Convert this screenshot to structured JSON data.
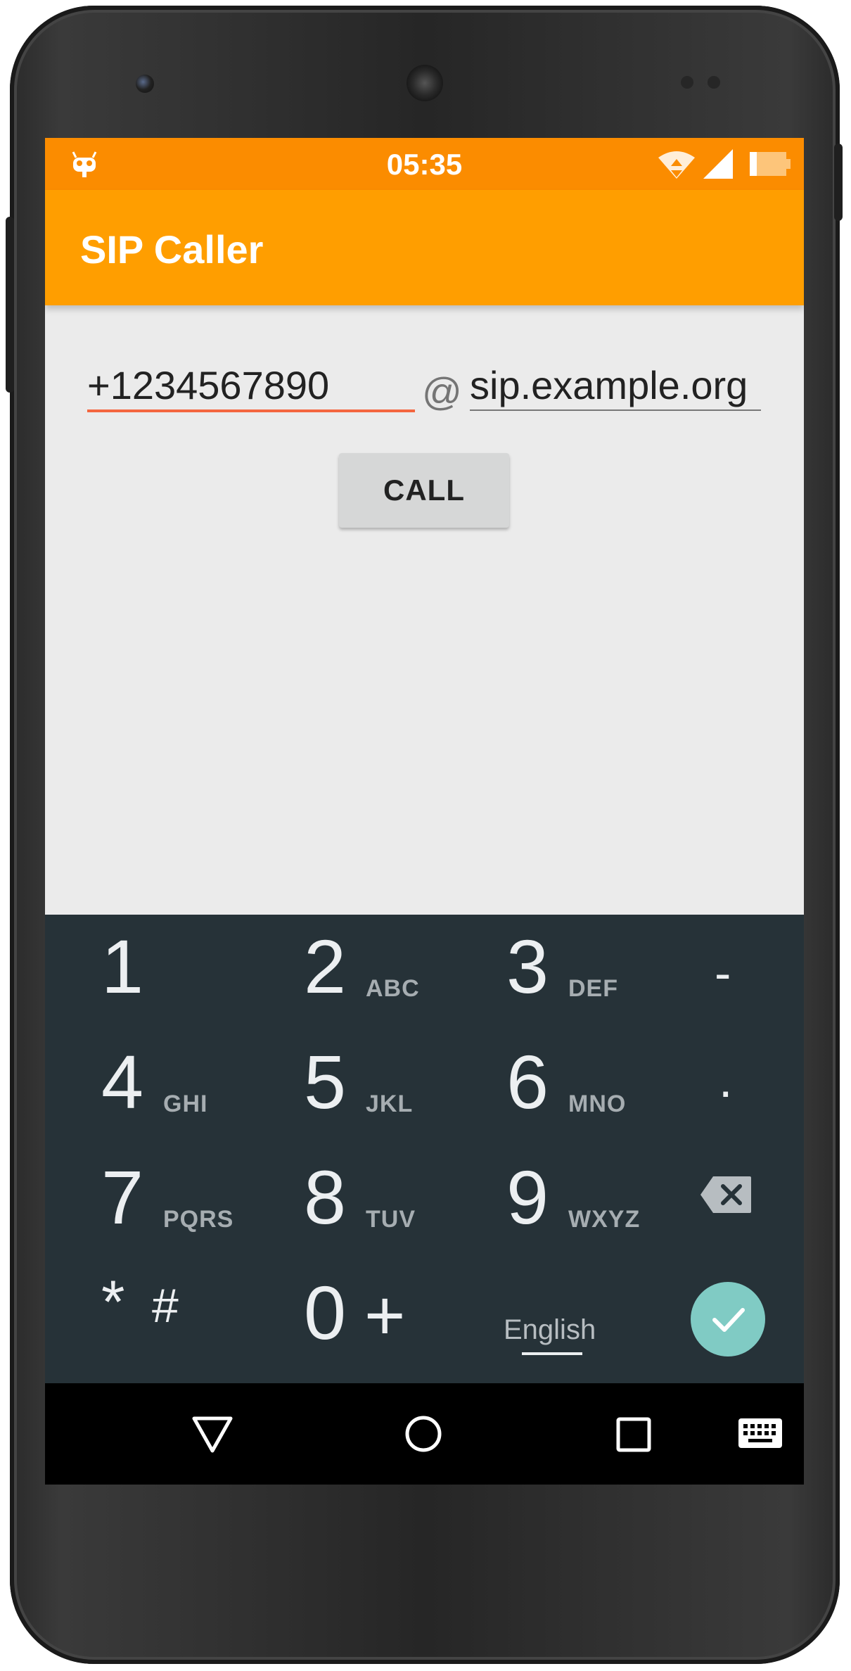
{
  "status_bar": {
    "time": "05:35",
    "icons": [
      "android-debug-icon",
      "wifi-icon",
      "signal-icon",
      "battery-icon"
    ]
  },
  "app_bar": {
    "title": "SIP Caller"
  },
  "form": {
    "number_value": "+1234567890",
    "at_symbol": "@",
    "domain_value": "sip.example.org",
    "call_label": "CALL"
  },
  "keypad": {
    "keys": [
      {
        "digit": "1",
        "letters": ""
      },
      {
        "digit": "2",
        "letters": "ABC"
      },
      {
        "digit": "3",
        "letters": "DEF"
      },
      {
        "digit": "4",
        "letters": "GHI"
      },
      {
        "digit": "5",
        "letters": "JKL"
      },
      {
        "digit": "6",
        "letters": "MNO"
      },
      {
        "digit": "7",
        "letters": "PQRS"
      },
      {
        "digit": "8",
        "letters": "TUV"
      },
      {
        "digit": "9",
        "letters": "WXYZ"
      }
    ],
    "dash": "-",
    "dot": ".",
    "star": "*",
    "hash": "#",
    "zero": "0",
    "plus": "+",
    "language": "English"
  },
  "colors": {
    "status_bar": "#fb8c00",
    "app_bar": "#ff9e00",
    "accent_underline": "#f4663f",
    "keypad_bg": "#263238",
    "done_button": "#80cbc4"
  },
  "nav_bar": {
    "icons": [
      "back-icon",
      "home-icon",
      "recents-icon",
      "keyboard-icon"
    ]
  }
}
